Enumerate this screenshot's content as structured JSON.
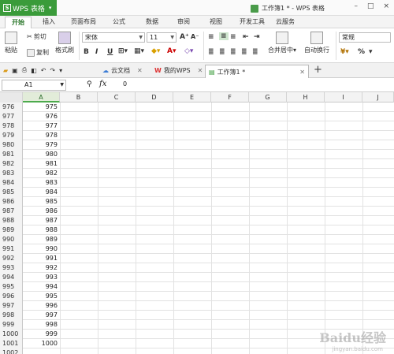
{
  "app": {
    "name": "WPS 表格",
    "logo": "S",
    "title": "工作簿1 * - WPS 表格"
  },
  "window_controls": [
    "–",
    "□",
    "×"
  ],
  "ribbon_tabs": [
    "开始",
    "插入",
    "页面布局",
    "公式",
    "数据",
    "审阅",
    "视图",
    "开发工具",
    "云服务"
  ],
  "ribbon": {
    "paste": "粘贴",
    "cut": "剪切",
    "copy": "复制",
    "format_painter": "格式刷",
    "font_family": "宋体",
    "font_size": "11",
    "bold": "B",
    "italic": "I",
    "underline": "U",
    "merge_center": "合并居中",
    "wrap_text": "自动换行",
    "number_format": "常规",
    "percent": "%"
  },
  "doc_tabs": [
    {
      "label": "云文档"
    },
    {
      "label": "我的WPS"
    },
    {
      "label": "工作簿1 *"
    }
  ],
  "formula_bar": {
    "cell": "A1",
    "fx": "fx",
    "value": "0"
  },
  "columns": [
    "A",
    "B",
    "C",
    "D",
    "E",
    "F",
    "G",
    "H",
    "I",
    "J"
  ],
  "rows": [
    {
      "n": "976",
      "a": "975"
    },
    {
      "n": "977",
      "a": "976"
    },
    {
      "n": "978",
      "a": "977"
    },
    {
      "n": "979",
      "a": "978"
    },
    {
      "n": "980",
      "a": "979"
    },
    {
      "n": "981",
      "a": "980"
    },
    {
      "n": "982",
      "a": "981"
    },
    {
      "n": "983",
      "a": "982"
    },
    {
      "n": "984",
      "a": "983"
    },
    {
      "n": "985",
      "a": "984"
    },
    {
      "n": "986",
      "a": "985"
    },
    {
      "n": "987",
      "a": "986"
    },
    {
      "n": "988",
      "a": "987"
    },
    {
      "n": "989",
      "a": "988"
    },
    {
      "n": "990",
      "a": "989"
    },
    {
      "n": "991",
      "a": "990"
    },
    {
      "n": "992",
      "a": "991"
    },
    {
      "n": "993",
      "a": "992"
    },
    {
      "n": "994",
      "a": "993"
    },
    {
      "n": "995",
      "a": "994"
    },
    {
      "n": "996",
      "a": "995"
    },
    {
      "n": "997",
      "a": "996"
    },
    {
      "n": "998",
      "a": "997"
    },
    {
      "n": "999",
      "a": "998"
    },
    {
      "n": "1000",
      "a": "999"
    },
    {
      "n": "1001",
      "a": "1000"
    },
    {
      "n": "1002",
      "a": ""
    }
  ],
  "watermark": "Baidu经验",
  "watermark_url": "jingyan.baidu.com",
  "colors": {
    "accent": "#3a9b3a"
  }
}
